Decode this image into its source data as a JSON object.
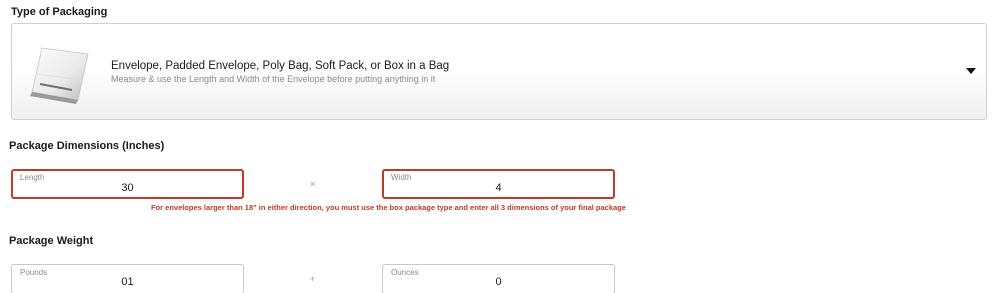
{
  "packaging": {
    "title": "Type of Packaging",
    "selected": {
      "name": "Envelope, Padded Envelope, Poly Bag, Soft Pack, or Box in a Bag",
      "hint": "Measure & use the Length and Width of the Envelope before putting anything in it",
      "icon": "poly-bag-icon"
    },
    "dropdown_icon": "caret-down-icon"
  },
  "dimensions": {
    "title": "Package Dimensions (Inches)",
    "length": {
      "label": "Length",
      "value": "30"
    },
    "separator": "×",
    "width": {
      "label": "Width",
      "value": "4"
    },
    "error": "For envelopes larger than 18\" in either direction, you must use the box package type and enter all 3 dimensions of your final package"
  },
  "weight": {
    "title": "Package Weight",
    "pounds": {
      "label": "Pounds",
      "value": "01"
    },
    "separator": "+",
    "ounces": {
      "label": "Ounces",
      "value": "0"
    }
  },
  "colors": {
    "error": "#c0392b",
    "border": "#cfcfcf",
    "label": "#8a8a8a"
  }
}
